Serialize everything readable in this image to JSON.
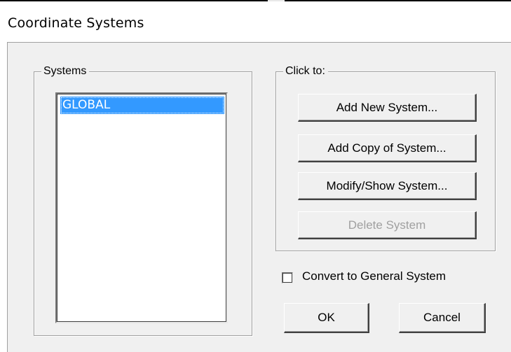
{
  "dialog": {
    "title": "Coordinate Systems"
  },
  "systems": {
    "label": "Systems",
    "items": [
      "GLOBAL"
    ],
    "selected": "GLOBAL"
  },
  "actions": {
    "label": "Click to:",
    "add_new": "Add New System...",
    "add_copy": "Add Copy of System...",
    "modify_show": "Modify/Show System...",
    "delete": "Delete System"
  },
  "options": {
    "convert_label": "Convert to General System",
    "convert_checked": false
  },
  "footer": {
    "ok": "OK",
    "cancel": "Cancel"
  },
  "colors": {
    "dialog_bg": "#f0f0f0",
    "selection": "#3399ff",
    "disabled_text": "#a0a0a0"
  }
}
